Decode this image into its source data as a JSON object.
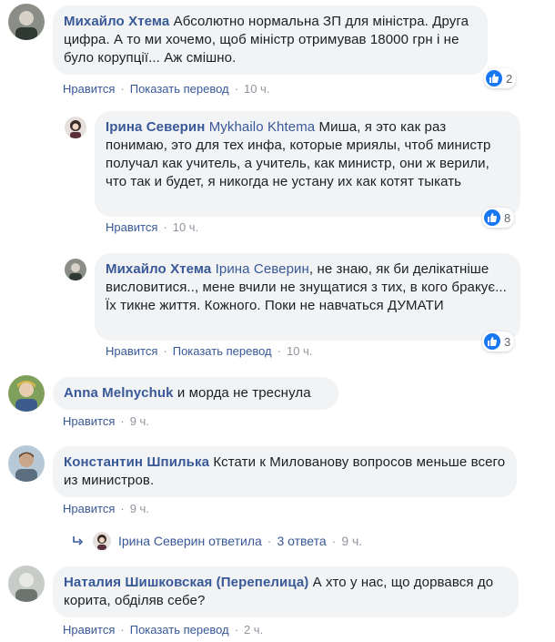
{
  "comments": [
    {
      "name": "Михайло Хтема",
      "mention": "",
      "text": "Абсолютно нормальна ЗП для міністра. Друга цифра. А то ми хочемо, щоб міністр отримував 18000 грн і не було корупції... Аж смішно.",
      "likes": "2",
      "actions": {
        "like": "Нравится",
        "translate": "Показать перевод",
        "time": "10 ч."
      }
    },
    {
      "name": "Ірина Северин",
      "mention": "Mykhailo Khtema",
      "text": "Миша, я это как раз понимаю, это для тех инфа, которые мриялы, чтоб министр получал как учитель, а учитель, как министр, они ж верили, что так и будет, я никогда не устану их как котят тыкать",
      "likes": "8",
      "actions": {
        "like": "Нравится",
        "time": "10 ч."
      }
    },
    {
      "name": "Михайло Хтема",
      "mention": "Ірина Северин",
      "text": ", не знаю, як би делікатніше висловитися.., мене вчили не знущатися з тих, в кого бракує... Їх тикне життя. Кожного. Поки не навчаться ДУМАТИ",
      "likes": "3",
      "actions": {
        "like": "Нравится",
        "translate": "Показать перевод",
        "time": "10 ч."
      }
    },
    {
      "name": "Anna Melnychuk",
      "mention": "",
      "text": "и морда не треснула",
      "actions": {
        "like": "Нравится",
        "time": "9 ч."
      }
    },
    {
      "name": "Константин Шпилька",
      "mention": "",
      "text": "Кстати к Милованову вопросов меньше всего из министров.",
      "actions": {
        "like": "Нравится",
        "time": "9 ч."
      }
    },
    {
      "name": "Наталия Шишковская (Перепелица)",
      "mention": "",
      "text": "А хто у нас, що дорвався до корита, обділяв себе?",
      "actions": {
        "like": "Нравится",
        "translate": "Показать перевод",
        "time": "2 ч."
      }
    }
  ],
  "reply_summary": {
    "text": "Ірина Северин ответила",
    "count": "3 ответа",
    "time": "9 ч."
  },
  "colors": {
    "link": "#385898",
    "bubble": "#f2f3f5",
    "like": "#1877f2",
    "meta": "#90949c"
  }
}
